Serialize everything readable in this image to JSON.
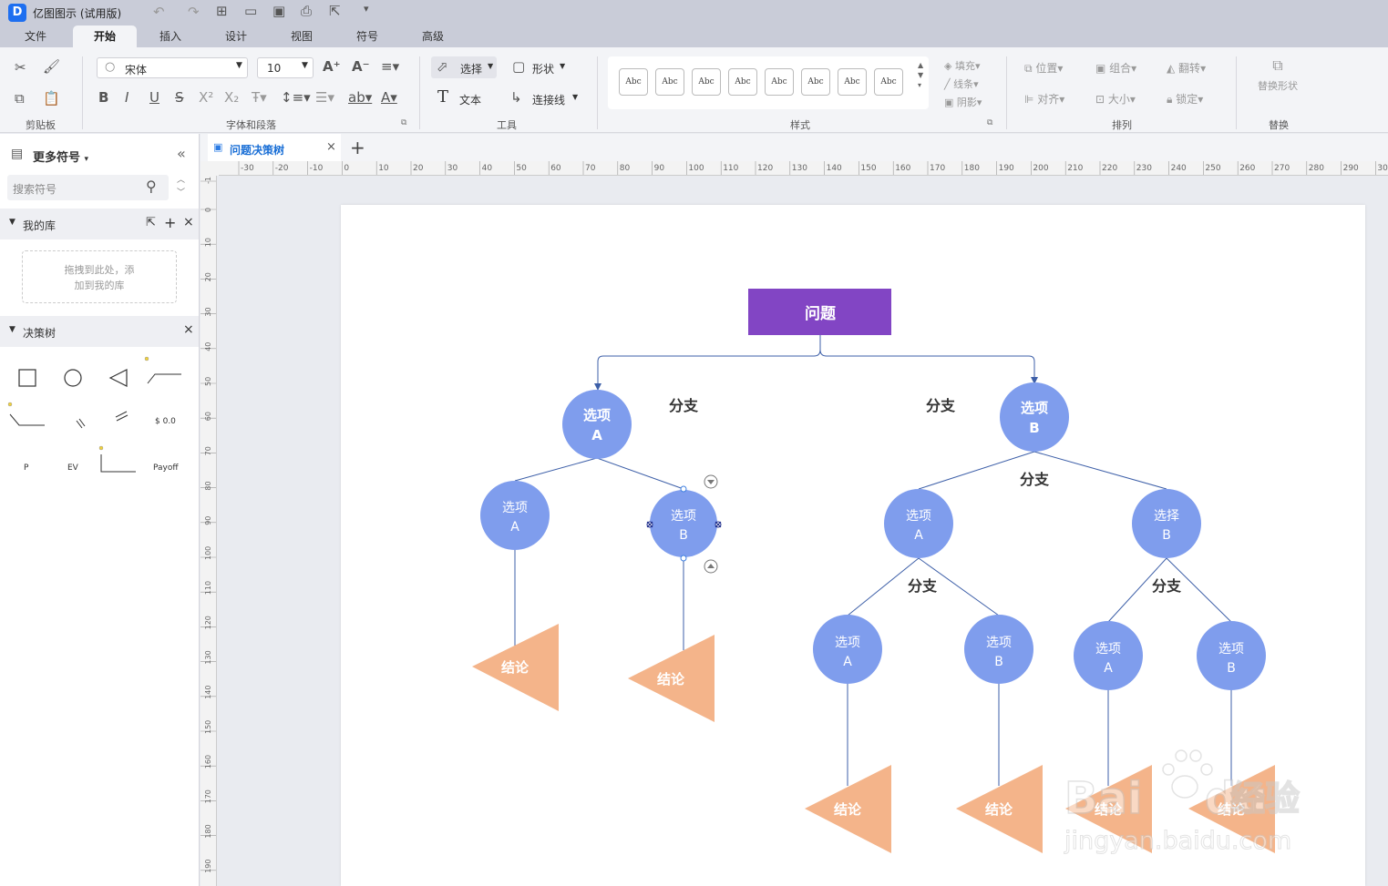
{
  "app": {
    "title": "亿图图示 (试用版)"
  },
  "menu": {
    "tabs": [
      "文件",
      "开始",
      "插入",
      "设计",
      "视图",
      "符号",
      "高级"
    ],
    "active": "开始"
  },
  "ribbon": {
    "font_name": "宋体",
    "font_size": "10",
    "groups": {
      "clipboard": "剪贴板",
      "font": "字体和段落",
      "tools": "工具",
      "style": "样式",
      "arrange": "排列",
      "replace": "替换"
    },
    "tools": {
      "select": "选择",
      "shape": "形状",
      "text": "文本",
      "connector": "连接线"
    },
    "style_sample": "Abc",
    "style_opts": {
      "fill": "填充",
      "line": "线条",
      "shadow": "阴影"
    },
    "arrange": {
      "position": "位置",
      "group": "组合",
      "flip": "翻转",
      "align": "对齐",
      "size": "大小",
      "lock": "锁定"
    },
    "replace_shape": "替换形状"
  },
  "sidebar": {
    "title": "更多符号",
    "search_placeholder": "搜索符号",
    "my_library": "我的库",
    "drop_hint_1": "拖拽到此处，添",
    "drop_hint_2": "加到我的库",
    "decision_tree": "决策树",
    "shape_labels": {
      "p": "P",
      "ev": "EV",
      "payoff": "Payoff",
      "money": "$ 0.0"
    }
  },
  "document": {
    "tab_title": "问题决策树"
  },
  "ruler": {
    "h": [
      "-30",
      "-20",
      "-10",
      "0",
      "10",
      "20",
      "30",
      "40",
      "50",
      "60",
      "70",
      "80",
      "90",
      "100",
      "110",
      "120",
      "130",
      "140",
      "150",
      "160",
      "170",
      "180",
      "190",
      "200",
      "210",
      "220",
      "230",
      "240",
      "250",
      "260",
      "270",
      "280",
      "290",
      "300"
    ],
    "v": [
      "-1",
      "0",
      "10",
      "20",
      "30",
      "40",
      "50",
      "60",
      "70",
      "80",
      "90",
      "100",
      "110",
      "120",
      "130",
      "140",
      "150",
      "160",
      "170",
      "180",
      "190"
    ]
  },
  "diagram": {
    "root": "问题",
    "branch_label": "分支",
    "option_label": "选项",
    "choice_label": "选择",
    "letter_a": "A",
    "letter_b": "B",
    "conclusion": "结论",
    "colors": {
      "root": "#8245c4",
      "circle": "#7f9ded",
      "triangle": "#f4b48a",
      "line": "#3d5fa8"
    }
  },
  "watermark": {
    "text_1": "Bai",
    "text_2": "du",
    "text_3": "经验",
    "url": "jingyan.baidu.com"
  }
}
